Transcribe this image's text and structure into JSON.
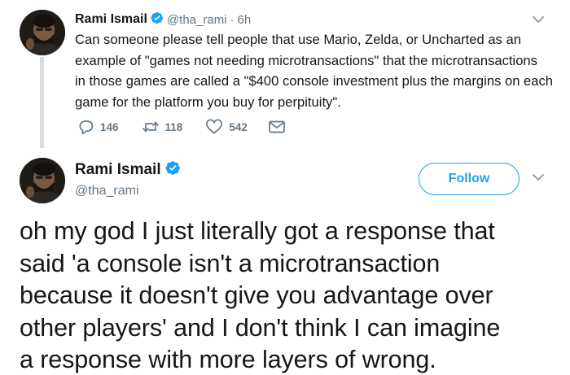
{
  "reply_tweet": {
    "author_name": "Rami Ismail",
    "author_handle": "@tha_rami",
    "separator": "·",
    "time": "6h",
    "text": "Can someone please tell people that use Mario, Zelda, or Uncharted as an\nexample of \"games not needing microtransactions\" that the microtransactions\nin those games are called a \"$400 console investment plus the margins on each\ngame for the platform you buy for perpituity\".",
    "replies_count": "146",
    "retweets_count": "118",
    "likes_count": "542"
  },
  "main_tweet": {
    "author_name": "Rami Ismail",
    "author_handle": "@tha_rami",
    "follow_label": "Follow",
    "text": "oh my god I just literally got a response that\nsaid 'a console isn't a microtransaction\nbecause it doesn't give you advantage over\nother players' and I don't think I can imagine\na response with more layers of wrong."
  },
  "icons": {
    "verified": "verified-badge-icon",
    "caret": "chevron-down-icon",
    "reply": "reply-icon",
    "retweet": "retweet-icon",
    "like": "heart-icon",
    "dm": "envelope-icon"
  },
  "colors": {
    "twitter_blue": "#1da1f2",
    "text_primary": "#14171a",
    "text_secondary": "#657786",
    "thread_line": "#d9dfe4"
  }
}
